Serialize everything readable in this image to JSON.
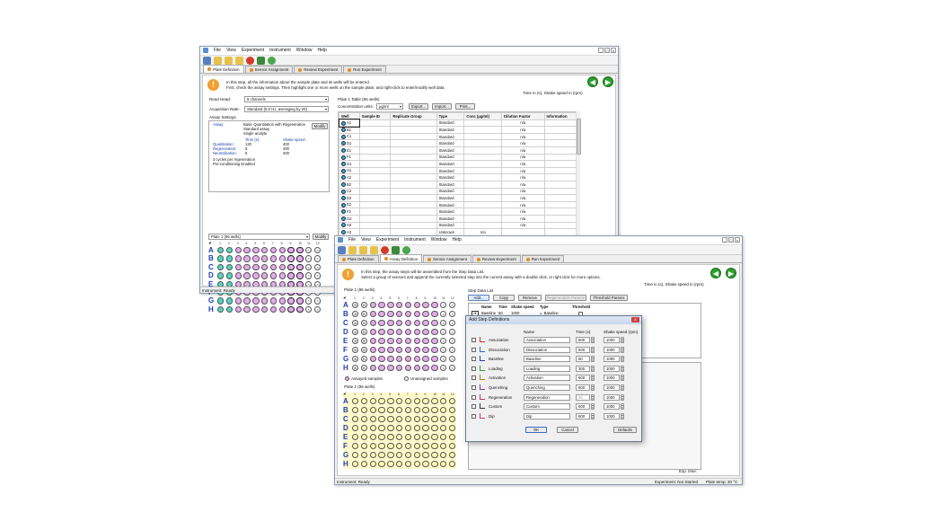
{
  "win1": {
    "menu": [
      "File",
      "View",
      "Experiment",
      "Instrument",
      "Window",
      "Help"
    ],
    "tabs": [
      "Plate Definition",
      "Sensor Assignment",
      "Review Experiment",
      "Run Experiment"
    ],
    "info_line1": "In this step, all the information about the sample plate and its wells will be entered.",
    "info_line2": "First, check the assay settings. Then highlight one or more wells on the sample plate, and right-click to enter/modify well data.",
    "time_note": "Time in (s), Shake speed in (rpm)",
    "read_head_label": "Read Head:",
    "read_head_value": "8 channels",
    "acq_label": "Acquisition Rate:",
    "acq_value": "Standard (5.0 Hz, averaging by 20)",
    "assay_settings_label": "Assay Settings",
    "assay_label": "Assay:",
    "assay_line1": "Basic Quantitation with Regeneration",
    "assay_line2": "Standard assay",
    "assay_line3": "Single analyte",
    "modify1": "Modify",
    "col_time": "Time (s):",
    "col_shake": "Shake speed:",
    "quant_label": "Quantitation:",
    "quant_time": "120",
    "quant_speed": "400",
    "regen_label": "Regeneration:",
    "regen_time": "5",
    "regen_speed": "400",
    "neut_label": "Neutralization:",
    "neut_time": "5",
    "neut_speed": "400",
    "cycles": "3 cycles per regeneration",
    "precond": "Pre-conditioning Enabled",
    "plate_select": "Plate 1 (96 wells)",
    "modify2": "Modify",
    "table_title": "Plate 1 Table (96 wells)",
    "conc_units_label": "Concentration units:",
    "conc_units_value": "µg/ml",
    "export": "Export...",
    "import": "Import...",
    "print": "Print...",
    "headers": [
      "Well",
      "Sample ID",
      "Replicate Group",
      "Type",
      "Conc (µg/ml)",
      "Dilution Factor",
      "Information"
    ],
    "rows": [
      {
        "well": "A1",
        "type": "Standard",
        "conc": "",
        "dil": "n/a"
      },
      {
        "well": "B1",
        "type": "Standard",
        "conc": "",
        "dil": "n/a"
      },
      {
        "well": "C1",
        "type": "Standard",
        "conc": "",
        "dil": "n/a"
      },
      {
        "well": "D1",
        "type": "Standard",
        "conc": "",
        "dil": "n/a"
      },
      {
        "well": "E1",
        "type": "Standard",
        "conc": "",
        "dil": "n/a"
      },
      {
        "well": "F1",
        "type": "Standard",
        "conc": "",
        "dil": "n/a"
      },
      {
        "well": "G1",
        "type": "Standard",
        "conc": "",
        "dil": "n/a"
      },
      {
        "well": "H1",
        "type": "Standard",
        "conc": "",
        "dil": "n/a"
      },
      {
        "well": "A2",
        "type": "Standard",
        "conc": "",
        "dil": "n/a"
      },
      {
        "well": "B2",
        "type": "Standard",
        "conc": "",
        "dil": "n/a"
      },
      {
        "well": "C2",
        "type": "Standard",
        "conc": "",
        "dil": "n/a"
      },
      {
        "well": "D2",
        "type": "Standard",
        "conc": "",
        "dil": "n/a"
      },
      {
        "well": "E2",
        "type": "Standard",
        "conc": "",
        "dil": "n/a"
      },
      {
        "well": "F2",
        "type": "Standard",
        "conc": "",
        "dil": "n/a"
      },
      {
        "well": "G2",
        "type": "Standard",
        "conc": "",
        "dil": "n/a"
      },
      {
        "well": "H2",
        "type": "Standard",
        "conc": "",
        "dil": "n/a"
      },
      {
        "well": "A3",
        "type": "Unknown",
        "conc": "n/a",
        "dil": ""
      }
    ],
    "status": "Instrument: Ready"
  },
  "win2": {
    "menu": [
      "File",
      "View",
      "Experiment",
      "Instrument",
      "Window",
      "Help"
    ],
    "tabs": [
      "Plate Definition",
      "Assay Definition",
      "Sensor Assignment",
      "Review Experiment",
      "Run Experiment"
    ],
    "info_line1": "In this step, the assay steps will be assembled from the Step Data List.",
    "info_line2": "Select a group of sensors and append the currently selected step into the current assay with a double click, or right click for more options.",
    "time_note": "Time in (s), Shake speed in (rpm)",
    "plate1_label": "Plate 1 (96 wells)",
    "plate2_label": "Plate 2 (96 wells)",
    "assayed": "Assayed samples",
    "unassigned": "Unassigned samples",
    "step_list_label": "Step Data List",
    "add": "Add...",
    "copy": "Copy",
    "remove": "Remove",
    "regen_params": "Regeneration Params",
    "threshold_params": "Threshold Params",
    "step_headers": [
      "Name",
      "Time",
      "Shake speed",
      "Type",
      "Threshold"
    ],
    "step_row": {
      "name": "Baseline",
      "time": "60",
      "speed": "1000",
      "type": "Baseline"
    },
    "exp_time": "Exp. time:",
    "status": "Instrument: Ready",
    "exp_status": "Experiment: Not Started",
    "plate_temp": "Plate temp: 30 °C"
  },
  "dialog": {
    "title": "Add Step Definitions",
    "col_name": "Name",
    "col_time": "Time (s)",
    "col_speed": "Shake speed (rpm)",
    "steps": [
      {
        "label": "Association",
        "name": "Association",
        "time": "600",
        "speed": "1000",
        "color": "#c0392b"
      },
      {
        "label": "Dissociation",
        "name": "Dissociation",
        "time": "600",
        "speed": "1000",
        "color": "#2c6cc4"
      },
      {
        "label": "Baseline",
        "name": "Baseline",
        "time": "60",
        "speed": "1000",
        "color": "#2c3ea8"
      },
      {
        "label": "Loading",
        "name": "Loading",
        "time": "300",
        "speed": "1000",
        "color": "#2e9a3a"
      },
      {
        "label": "Activation",
        "name": "Activation",
        "time": "600",
        "speed": "1000",
        "color": "#c07a1a"
      },
      {
        "label": "Quenching",
        "name": "Quenching",
        "time": "600",
        "speed": "1000",
        "color": "#7a3aa8"
      },
      {
        "label": "Regeneration",
        "name": "Regeneration",
        "time": "30",
        "speed": "1000",
        "color": "#b03a6a"
      },
      {
        "label": "Custom",
        "name": "Custom",
        "time": "600",
        "speed": "1000",
        "color": "#333333"
      },
      {
        "label": "Dip",
        "name": "Dip",
        "time": "600",
        "speed": "1000",
        "color": "#c03a9a"
      }
    ],
    "ok": "OK",
    "cancel": "Cancel",
    "defaults": "Defaults"
  },
  "plate_rows": [
    "A",
    "B",
    "C",
    "D",
    "E",
    "F",
    "G",
    "H"
  ],
  "plate_cols": [
    "1",
    "2",
    "3",
    "4",
    "5",
    "6",
    "7",
    "8",
    "9",
    "10",
    "11",
    "12"
  ],
  "colors": {
    "teal": "#4fd6c2",
    "pink": "#e6a8ec",
    "yellow": "#fff7b0",
    "navy": "#1b3fb0"
  }
}
